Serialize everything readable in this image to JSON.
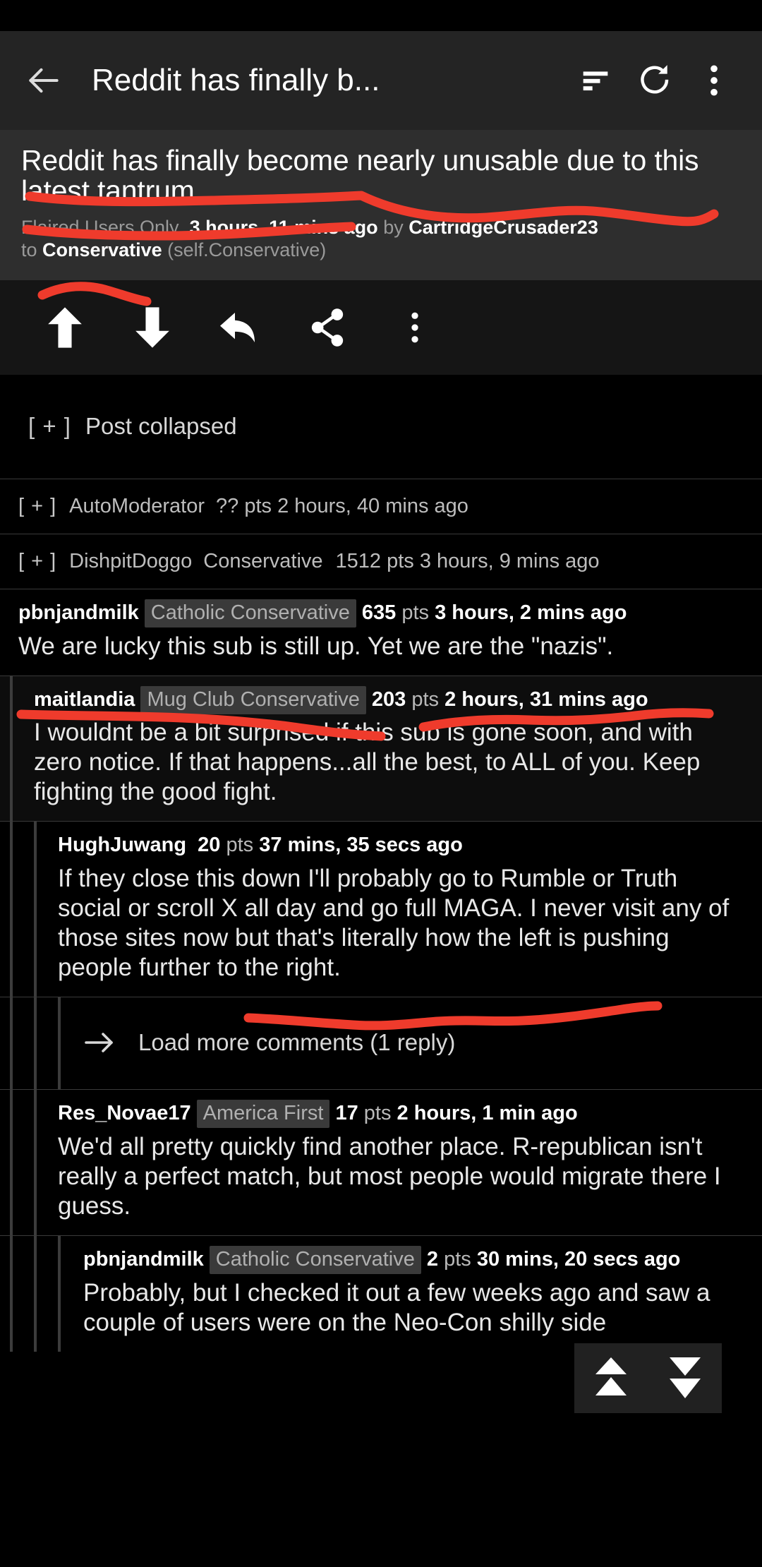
{
  "app_bar": {
    "title": "Reddit has finally b...",
    "back_icon": "back-arrow-icon",
    "sort_icon": "sort-icon",
    "refresh_icon": "refresh-icon",
    "overflow_icon": "overflow-menu-icon"
  },
  "post": {
    "title": "Reddit has finally become nearly unusable due to this latest tantrum",
    "flair": "Flaired Users Only",
    "time": "3 hours, 11 mins ago",
    "by_label": "by",
    "author": "CartridgeCrusader23",
    "to_label": "to",
    "subreddit": "Conservative",
    "domain": "(self.Conservative)",
    "collapsed_toggle": "[ + ]",
    "collapsed_label": "Post collapsed"
  },
  "actions": [
    {
      "name": "upvote-button",
      "icon": "upvote-arrow-icon"
    },
    {
      "name": "downvote-button",
      "icon": "downvote-arrow-icon"
    },
    {
      "name": "reply-button",
      "icon": "reply-arrow-icon"
    },
    {
      "name": "share-button",
      "icon": "share-icon"
    },
    {
      "name": "post-overflow-button",
      "icon": "overflow-menu-icon"
    }
  ],
  "comments": {
    "c0": {
      "toggle": "[ + ]",
      "user": "AutoModerator",
      "score": "?? pts",
      "time": "2 hours, 40 mins ago"
    },
    "c1": {
      "toggle": "[ + ]",
      "user": "DishpitDoggo",
      "flair": "Conservative",
      "score": "1512 pts",
      "time": "3 hours, 9 mins ago"
    },
    "c2": {
      "user": "pbnjandmilk",
      "flair": "Catholic Conservative",
      "score": "635",
      "pts": "pts",
      "time": "3 hours, 2 mins ago",
      "body": "We are lucky this sub is still up. Yet we are the \"nazis\"."
    },
    "c3": {
      "user": "maitlandia",
      "flair": "Mug Club Conservative",
      "score": "203",
      "pts": "pts",
      "time": "2 hours, 31 mins ago",
      "body": "I wouldnt be a bit surprised if this sub is gone soon, and with zero notice. If that happens...all the best, to ALL of you. Keep fighting the good fight."
    },
    "c4": {
      "user": "HughJuwang",
      "score": "20",
      "pts": "pts",
      "time": "37 mins, 35 secs ago",
      "body": "If they close this down I'll probably go to Rumble or Truth social or scroll X all day and go full MAGA. I never visit any of those sites now but that's literally how the left is pushing people further to the right."
    },
    "load_more": {
      "label": "Load more comments (1 reply)",
      "icon": "right-arrow-icon"
    },
    "c5": {
      "user": "Res_Novae17",
      "flair": "America First",
      "score": "17",
      "pts": "pts",
      "time": "2 hours, 1 min ago",
      "body": "We'd all pretty quickly find another place. R-republican isn't really a perfect match, but most people would migrate there I guess."
    },
    "c6": {
      "user": "pbnjandmilk",
      "flair": "Catholic Conservative",
      "score": "2",
      "pts": "pts",
      "time": "30 mins, 20 secs ago",
      "body": "Probably, but I checked it out a few weeks ago and saw a couple of users were on the Neo-Con shilly side"
    }
  },
  "float_nav": {
    "up_icon": "double-chevron-up-icon",
    "down_icon": "double-chevron-down-icon"
  },
  "annotations": {
    "color": "#ef3b2c",
    "marks": [
      "underline-post-title-line1",
      "underline-post-title-line2",
      "underline-subreddit",
      "underline-we-are-lucky",
      "underline-yet-we-are-nazis",
      "underline-scroll-x-maga"
    ]
  },
  "colors": {
    "app_bar_bg": "#242424",
    "post_header_bg": "#2e2e2e",
    "action_bar_bg": "#151515",
    "page_bg": "#000000",
    "flair_badge_bg": "#3a3a3a",
    "divider": "#3a3a3a",
    "annotation_red": "#ef3b2c"
  }
}
